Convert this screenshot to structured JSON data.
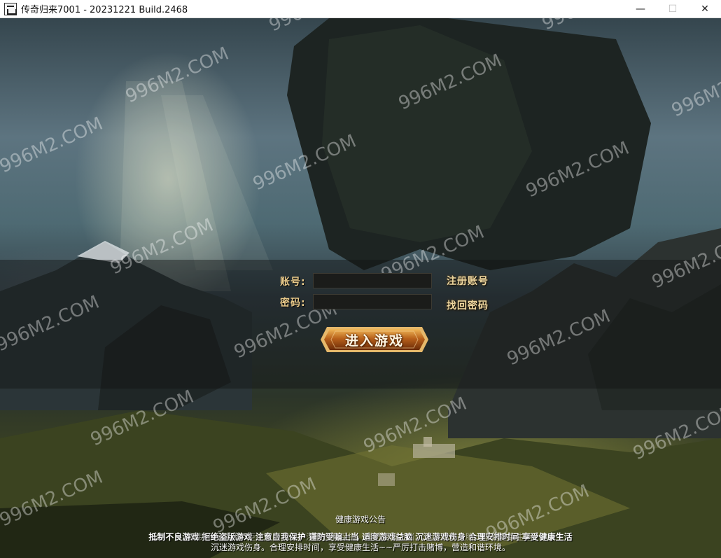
{
  "window": {
    "title": "传奇归来7001 - 20231221 Build.2468",
    "icon": "app-icon",
    "controls": {
      "minimize": "—",
      "maximize": "☐",
      "close": "✕"
    }
  },
  "login": {
    "account_label": "账号:",
    "password_label": "密码:",
    "account_value": "",
    "password_value": "",
    "register_label": "注册账号",
    "recover_label": "找回密码",
    "enter_label": "进入游戏"
  },
  "notice": {
    "title": "健康游戏公告",
    "line1": "抵制不良游戏 拒绝盗版游戏 注意自我保护 谨防受骗上当 适度游戏益脑 沉迷游戏伤身 合理安排时间 享受健康生活",
    "line2": "抵制不良游戏，拒绝盗版游戏，注意自我保护，谨防受骗上当。适度游戏益脑，享受健康生活",
    "line3": "沉迷游戏伤身。合理安排时间，享受健康生活~~严厉打击赌博，营造和谐环境。"
  },
  "watermark_text": "996M2.COM",
  "colors": {
    "label_gold": "#e8c98a",
    "button_gold": "#d99a35",
    "button_red": "#7a2a0a"
  }
}
